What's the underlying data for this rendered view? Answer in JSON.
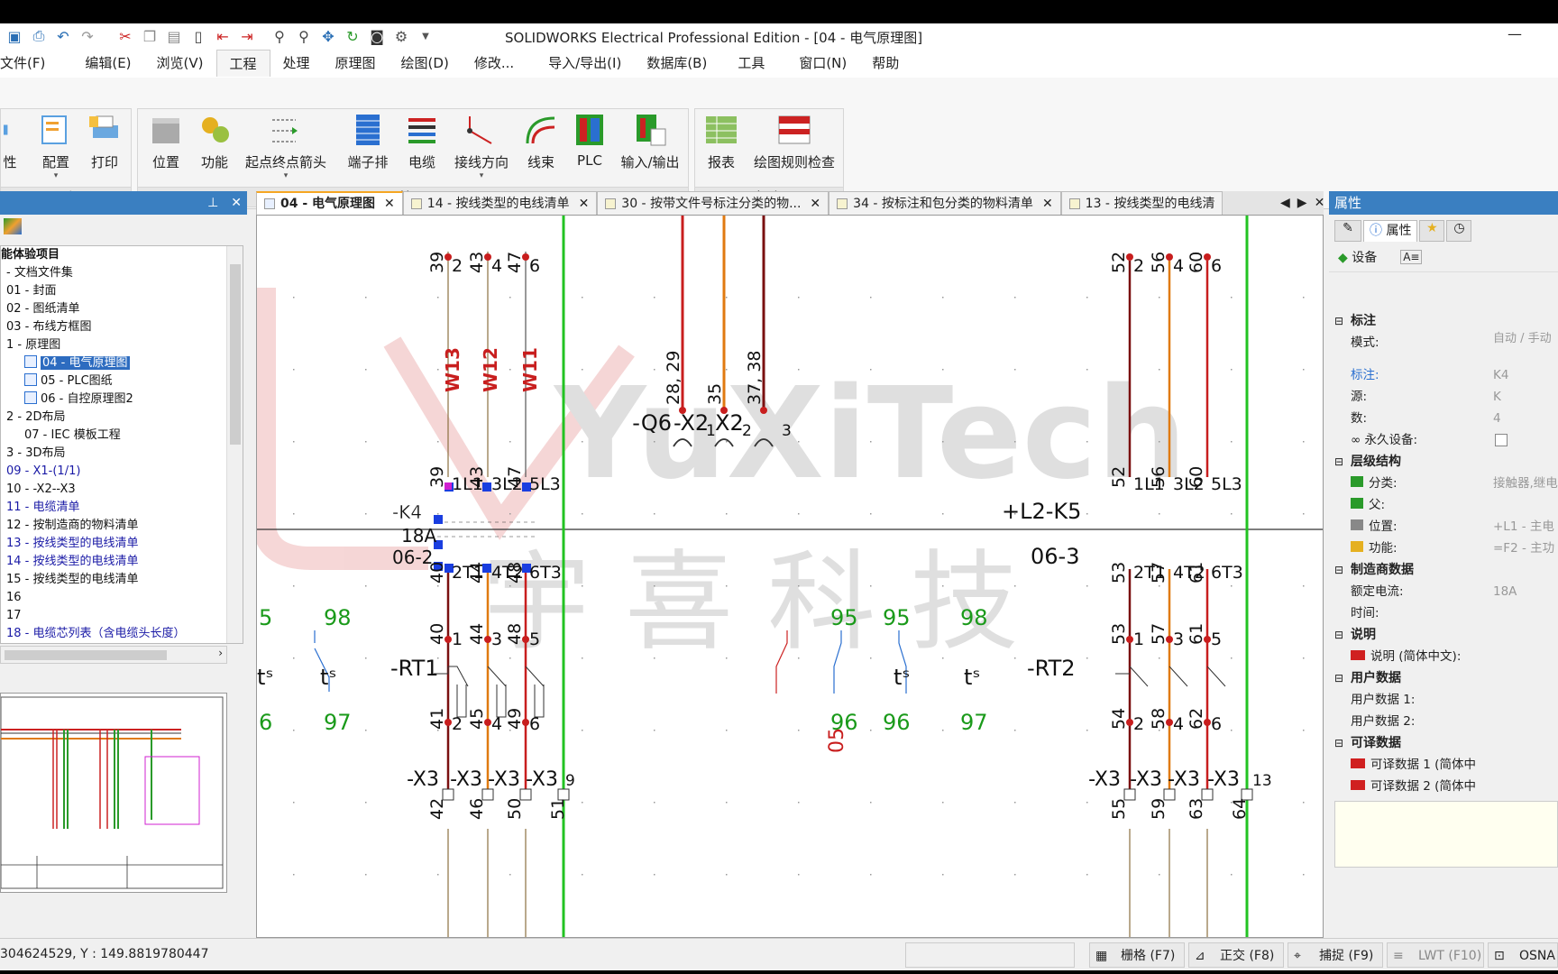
{
  "title": "SOLIDWORKS Electrical Professional Edition - [04 - 电气原理图]",
  "menu": [
    "文件(F)",
    "编辑(E)",
    "浏览(V)",
    "工程",
    "处理",
    "原理图",
    "绘图(D)",
    "修改...",
    "导入/导出(I)",
    "数据库(B)",
    "工具",
    "窗口(N)",
    "帮助"
  ],
  "menu_active": "工程",
  "ribbon": {
    "group1": {
      "label": "工程",
      "buttons": [
        "性",
        "配置",
        "打印"
      ]
    },
    "group2": {
      "label": "管理",
      "buttons": [
        "位置",
        "功能",
        "起点终点箭头",
        "端子排",
        "电缆",
        "接线方向",
        "线束",
        "PLC",
        "输入/输出"
      ]
    },
    "group3": {
      "label": "报表",
      "buttons": [
        "报表",
        "绘图规则检查"
      ]
    }
  },
  "tree": {
    "items": [
      {
        "label": "能体验项目",
        "style": "bold"
      },
      {
        "label": "- 文档文件集",
        "style": "normal"
      },
      {
        "label": "01 - 封面",
        "style": "normal"
      },
      {
        "label": "02 - 图纸清单",
        "style": "normal"
      },
      {
        "label": "03 - 布线方框图",
        "style": "normal"
      },
      {
        "label": "1 - 原理图",
        "style": "normal"
      },
      {
        "label": "04 - 电气原理图",
        "style": "selected"
      },
      {
        "label": "05 - PLC图纸",
        "style": "normal"
      },
      {
        "label": "06 - 自控原理图2",
        "style": "normal"
      },
      {
        "label": "2 - 2D布局",
        "style": "normal"
      },
      {
        "label": "07 - IEC 模板工程",
        "style": "normal"
      },
      {
        "label": "3 - 3D布局",
        "style": "normal"
      },
      {
        "label": "09 - X1-(1/1)",
        "style": "link"
      },
      {
        "label": "10 - -X2--X3",
        "style": "normal"
      },
      {
        "label": "11 - 电缆清单",
        "style": "link"
      },
      {
        "label": "12 - 按制造商的物料清单",
        "style": "normal"
      },
      {
        "label": "13 - 按线类型的电线清单",
        "style": "link"
      },
      {
        "label": "14 - 按线类型的电线清单",
        "style": "link"
      },
      {
        "label": "15 - 按线类型的电线清单",
        "style": "normal"
      },
      {
        "label": "16",
        "style": "normal"
      },
      {
        "label": "17",
        "style": "normal"
      },
      {
        "label": "18 - 电缆芯列表（含电缆头长度）",
        "style": "link"
      }
    ]
  },
  "doc_tabs": [
    {
      "label": "04 - 电气原理图",
      "active": true
    },
    {
      "label": "14 - 按线类型的电线清单",
      "active": false
    },
    {
      "label": "30 - 按带文件号标注分类的物...",
      "active": false
    },
    {
      "label": "34 - 按标注和包分类的物料清单",
      "active": false
    },
    {
      "label": "13 - 按线类型的电线清",
      "active": false
    }
  ],
  "schematic": {
    "watermark_brand": "YuXiTech",
    "watermark_cn": "宇 喜 科 技",
    "labels": {
      "q6": "-Q6",
      "x2a": "-X2",
      "x2b": "X2",
      "k4": "-K4",
      "k4_current": "18A",
      "k4_ref": "06-2",
      "l2k5": "+L2-K5",
      "k5_ref": "06-3",
      "rt1": "-RT1",
      "rt2": "-RT2",
      "w13": "W13",
      "w12": "W12",
      "w11": "W11",
      "wire_28_29": "28, 29",
      "wire_35": "35",
      "wire_37_38": "37, 38",
      "term_1": "1",
      "term_2": "2",
      "term_3": "3",
      "term_9": "9",
      "term_13": "13",
      "n95a": "95",
      "n95b": "95",
      "n98a": "98",
      "n98b": "98",
      "n96a": "96",
      "n96b": "96",
      "n97a": "97",
      "n97b": "97",
      "n05": "05",
      "n5": "5",
      "n6": "6",
      "x3": "-X3"
    }
  },
  "properties": {
    "panel_title": "属性",
    "tab_label": "属性",
    "device_tab": "设备",
    "sections": [
      {
        "title": "标注",
        "rows": [
          {
            "label": "模式:",
            "value": "自动 / 手动"
          },
          {
            "label": "标注:",
            "value": "K4"
          },
          {
            "label": "源:",
            "value": "K"
          },
          {
            "label": "数:",
            "value": "4"
          },
          {
            "label": "永久设备:",
            "value": ""
          }
        ]
      },
      {
        "title": "层级结构",
        "rows": [
          {
            "label": "分类:",
            "value": "接触器,继电"
          },
          {
            "label": "父:",
            "value": ""
          },
          {
            "label": "位置:",
            "value": "+L1 - 主电"
          },
          {
            "label": "功能:",
            "value": "=F2 - 主功"
          }
        ]
      },
      {
        "title": "制造商数据",
        "rows": [
          {
            "label": "额定电流:",
            "value": "18A"
          },
          {
            "label": "时间:",
            "value": ""
          }
        ]
      },
      {
        "title": "说明",
        "rows": [
          {
            "label": "说明 (简体中文):",
            "value": ""
          }
        ]
      },
      {
        "title": "用户数据",
        "rows": [
          {
            "label": "用户数据 1:",
            "value": ""
          },
          {
            "label": "用户数据 2:",
            "value": ""
          }
        ]
      },
      {
        "title": "可译数据",
        "rows": [
          {
            "label": "可译数据 1 (简体中",
            "value": ""
          },
          {
            "label": "可译数据 2 (简体中",
            "value": ""
          }
        ]
      }
    ]
  },
  "status": {
    "coords": "304624529, Y : 149.8819780447",
    "buttons": [
      {
        "label": "栅格 (F7)",
        "on": true
      },
      {
        "label": "正交 (F8)",
        "on": true
      },
      {
        "label": "捕捉 (F9)",
        "on": true
      },
      {
        "label": "LWT (F10)",
        "on": false
      },
      {
        "label": "OSNA",
        "on": true
      }
    ]
  },
  "colors": {
    "accent": "#3a7fc1",
    "wire_red": "#c81e1e",
    "wire_orange": "#e07a10",
    "wire_darkred": "#7a1010",
    "wire_green": "#22c322",
    "note_green": "#1a9a1a"
  }
}
